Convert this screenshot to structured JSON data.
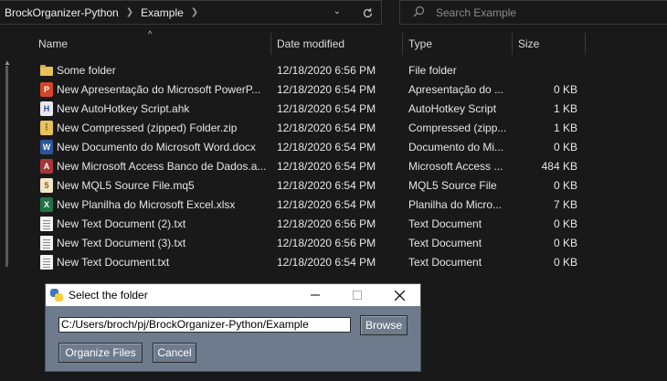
{
  "address": {
    "crumbs": [
      "BrockOrganizer-Python",
      "Example"
    ],
    "search_placeholder": "Search Example"
  },
  "columns": {
    "name": "Name",
    "date": "Date modified",
    "type": "Type",
    "size": "Size"
  },
  "files": [
    {
      "name": "Some folder",
      "date": "12/18/2020 6:56 PM",
      "type": "File folder",
      "size": "",
      "icon": "folder-icon"
    },
    {
      "name": "New Apresentação do Microsoft PowerP...",
      "date": "12/18/2020 6:54 PM",
      "type": "Apresentação do ...",
      "size": "0 KB",
      "icon": "powerpoint-icon"
    },
    {
      "name": "New AutoHotkey Script.ahk",
      "date": "12/18/2020 6:54 PM",
      "type": "AutoHotkey Script",
      "size": "1 KB",
      "icon": "autohotkey-icon"
    },
    {
      "name": "New Compressed (zipped) Folder.zip",
      "date": "12/18/2020 6:54 PM",
      "type": "Compressed (zipp...",
      "size": "1 KB",
      "icon": "zip-folder-icon"
    },
    {
      "name": "New Documento do Microsoft Word.docx",
      "date": "12/18/2020 6:54 PM",
      "type": "Documento do Mi...",
      "size": "0 KB",
      "icon": "word-icon"
    },
    {
      "name": "New Microsoft Access Banco de Dados.a...",
      "date": "12/18/2020 6:54 PM",
      "type": "Microsoft Access ...",
      "size": "484 KB",
      "icon": "access-icon"
    },
    {
      "name": "New MQL5 Source File.mq5",
      "date": "12/18/2020 6:54 PM",
      "type": "MQL5 Source File",
      "size": "0 KB",
      "icon": "mql5-icon"
    },
    {
      "name": "New Planilha do Microsoft Excel.xlsx",
      "date": "12/18/2020 6:54 PM",
      "type": "Planilha do Micro...",
      "size": "7 KB",
      "icon": "excel-icon"
    },
    {
      "name": "New Text Document (2).txt",
      "date": "12/18/2020 6:56 PM",
      "type": "Text Document",
      "size": "0 KB",
      "icon": "text-document-icon"
    },
    {
      "name": "New Text Document (3).txt",
      "date": "12/18/2020 6:56 PM",
      "type": "Text Document",
      "size": "0 KB",
      "icon": "text-document-icon"
    },
    {
      "name": "New Text Document.txt",
      "date": "12/18/2020 6:54 PM",
      "type": "Text Document",
      "size": "0 KB",
      "icon": "text-document-icon"
    }
  ],
  "dialog": {
    "title": "Select the folder",
    "path_value": "C:/Users/broch/pj/BrockOrganizer-Python/Example",
    "browse_label": "Browse",
    "organize_label": "Organize Files",
    "cancel_label": "Cancel"
  },
  "colors": {
    "background": "#191919",
    "dialog_bg": "#6d7b8d",
    "folder": "#e9c15a"
  }
}
